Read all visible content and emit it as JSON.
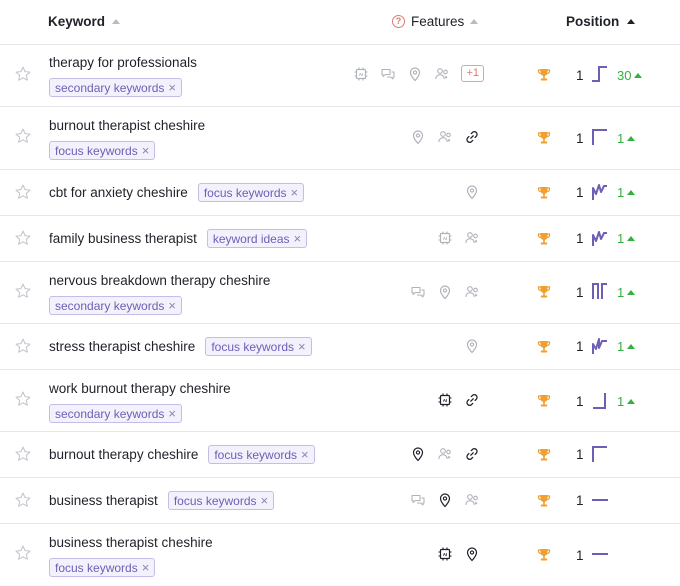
{
  "header": {
    "keyword_label": "Keyword",
    "features_label": "Features",
    "features_help": "?",
    "position_label": "Position"
  },
  "rows": [
    {
      "keyword": "therapy for professionals",
      "tag": "secondary keywords",
      "position": "1",
      "change": "30"
    },
    {
      "keyword": "burnout therapist cheshire",
      "tag": "focus keywords",
      "position": "1",
      "change": "1"
    },
    {
      "keyword": "cbt for anxiety cheshire",
      "tag": "focus keywords",
      "position": "1",
      "change": "1"
    },
    {
      "keyword": "family business therapist",
      "tag": "keyword ideas",
      "position": "1",
      "change": "1"
    },
    {
      "keyword": "nervous breakdown therapy cheshire",
      "tag": "secondary keywords",
      "position": "1",
      "change": "1"
    },
    {
      "keyword": "stress therapist cheshire",
      "tag": "focus keywords",
      "position": "1",
      "change": "1"
    },
    {
      "keyword": "work burnout therapy cheshire",
      "tag": "secondary keywords",
      "position": "1",
      "change": "1"
    },
    {
      "keyword": "burnout therapy cheshire",
      "tag": "focus keywords",
      "position": "1",
      "change": ""
    },
    {
      "keyword": "business therapist",
      "tag": "focus keywords",
      "position": "1",
      "change": ""
    },
    {
      "keyword": "business therapist cheshire",
      "tag": "focus keywords",
      "position": "1",
      "change": ""
    }
  ],
  "extra_features_badge": "+1",
  "tag_remove_glyph": "×",
  "colors": {
    "tag_border": "#c4bde8",
    "tag_text": "#6d5fb5",
    "trophy": "#f0a030",
    "change_up": "#34b13c",
    "sparkline": "#6d5fb5",
    "icon_muted": "#b0b2ba",
    "icon_dark": "#1f2129"
  }
}
